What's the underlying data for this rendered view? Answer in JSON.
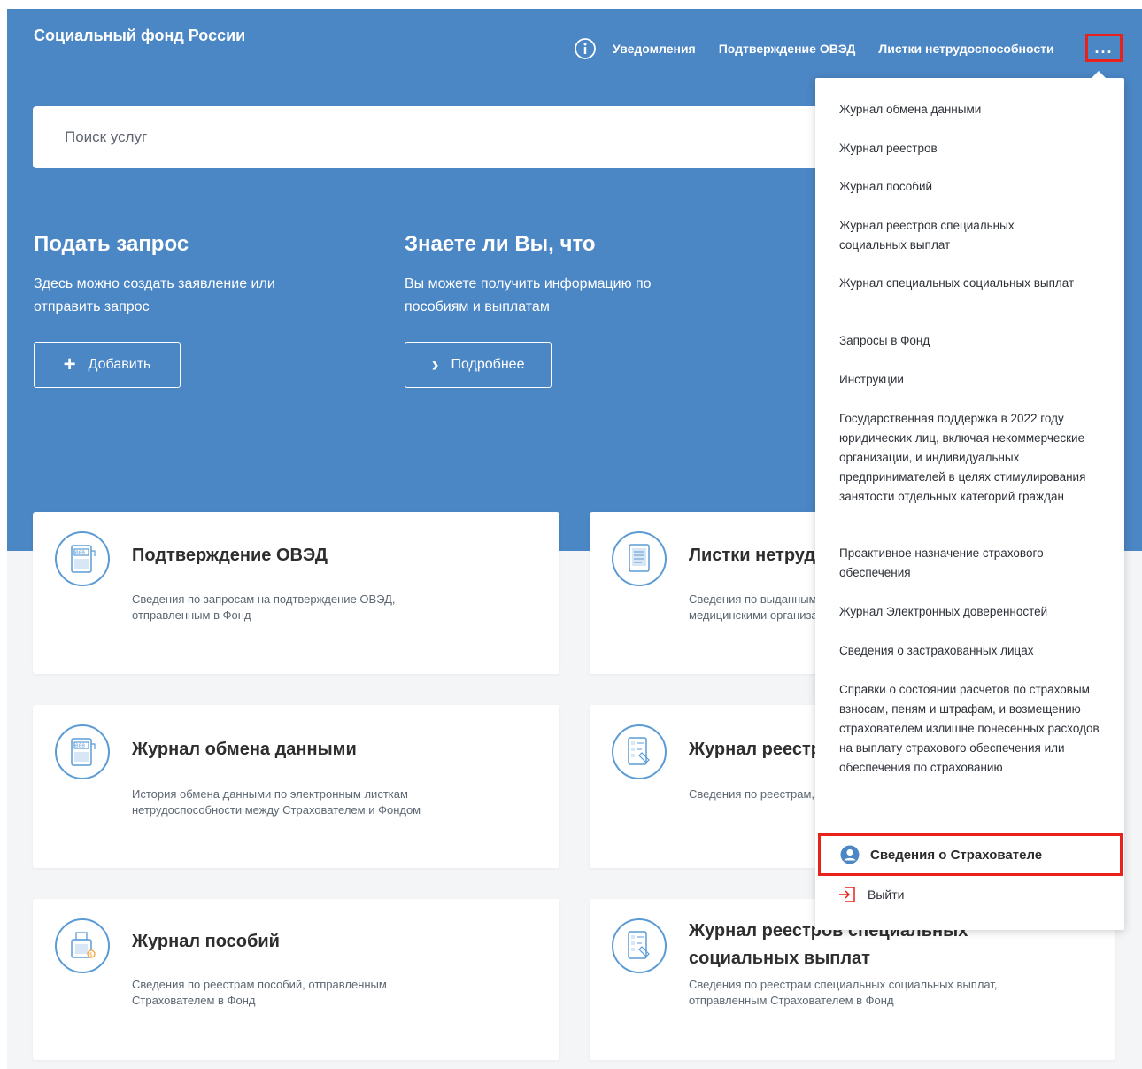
{
  "header": {
    "brand": "Социальный фонд России",
    "nav": [
      "Уведомления",
      "Подтверждение ОВЭД",
      "Листки нетрудоспособности"
    ],
    "more_label": "..."
  },
  "search": {
    "placeholder": "Поиск услуг"
  },
  "promo": {
    "request": {
      "title": "Подать запрос",
      "text": "Здесь можно создать заявление или отправить запрос",
      "button": "Добавить"
    },
    "know": {
      "title": "Знаете ли Вы, что",
      "text": "Вы можете получить информацию по пособиям и выплатам",
      "button": "Подробнее"
    }
  },
  "cards": [
    {
      "title": "Подтверждение ОВЭД",
      "desc": "Сведения по запросам на подтверждение ОВЭД, отправленным в Фонд"
    },
    {
      "title": "Листки нетрудоспособности",
      "desc": "Сведения по выданным листкам нетрудоспособности, переданные медицинскими организациями в электронном виде"
    },
    {
      "title": "Журнал обмена данными",
      "desc": "История обмена данными по электронным листкам нетрудоспособности между Страхователем и Фондом"
    },
    {
      "title": "Журнал реестров",
      "desc": "Сведения по реестрам, отправленным Страхователем в Фонд"
    },
    {
      "title": "Журнал пособий",
      "desc": "Сведения по реестрам пособий, отправленным Страхователем в Фонд"
    },
    {
      "title": "Журнал реестров специальных социальных выплат",
      "desc": "Сведения по реестрам специальных социальных выплат, отправленным Страхователем в Фонд"
    }
  ],
  "dropdown": {
    "items": [
      "Журнал обмена данными",
      "Журнал реестров",
      "Журнал пособий",
      "Журнал реестров специальных социальных выплат",
      "Журнал специальных социальных выплат",
      "Запросы в Фонд",
      "Инструкции",
      "Государственная поддержка в 2022 году юридических лиц, включая некоммерческие организации, и индивидуальных предпринимателей в целях стимулирования занятости отдельных категорий граждан",
      "Проактивное назначение страхового обеспечения",
      "Журнал Электронных доверенностей",
      "Сведения о застрахованных лицах",
      "Справки о состоянии расчетов по страховым взносам, пеням и штрафам, и возмещению страхователем излишне понесенных расходов на выплату страхового обеспечения или обеспечения по страхованию"
    ],
    "insurer_info": "Сведения о Страхователе",
    "logout": "Выйти"
  },
  "colors": {
    "hero": "#4b86c5",
    "icon": "#5b9bd5",
    "highlight": "#e8221b"
  }
}
